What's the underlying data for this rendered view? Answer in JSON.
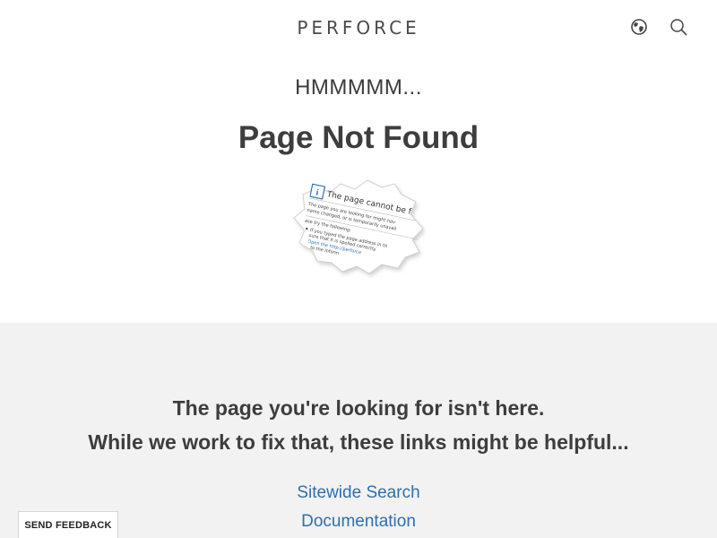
{
  "header": {
    "logo_text": "PERFORCE",
    "icons": [
      "globe-icon",
      "search-icon"
    ]
  },
  "hero": {
    "eyebrow": "HMMMMM...",
    "title": "Page Not Found",
    "image": {
      "heading": "The page cannot be f",
      "lines": [
        "The page you are looking for might hav",
        "name changed, or is temporarily unavail",
        "ase try the following:",
        "If you typed the page address in th",
        "sure that it is spelled correctly.",
        "Open the http://perforce",
        "s to the inform"
      ]
    }
  },
  "help": {
    "line1": "The page you're looking for isn't here.",
    "line2": "While we work to fix that, these links might be helpful...",
    "links": [
      {
        "label": "Sitewide Search"
      },
      {
        "label": "Documentation"
      }
    ]
  },
  "feedback": {
    "label": "SEND FEEDBACK"
  },
  "colors": {
    "link": "#2f6fae",
    "text": "#3d3d3d",
    "band": "#f2f2f2"
  }
}
